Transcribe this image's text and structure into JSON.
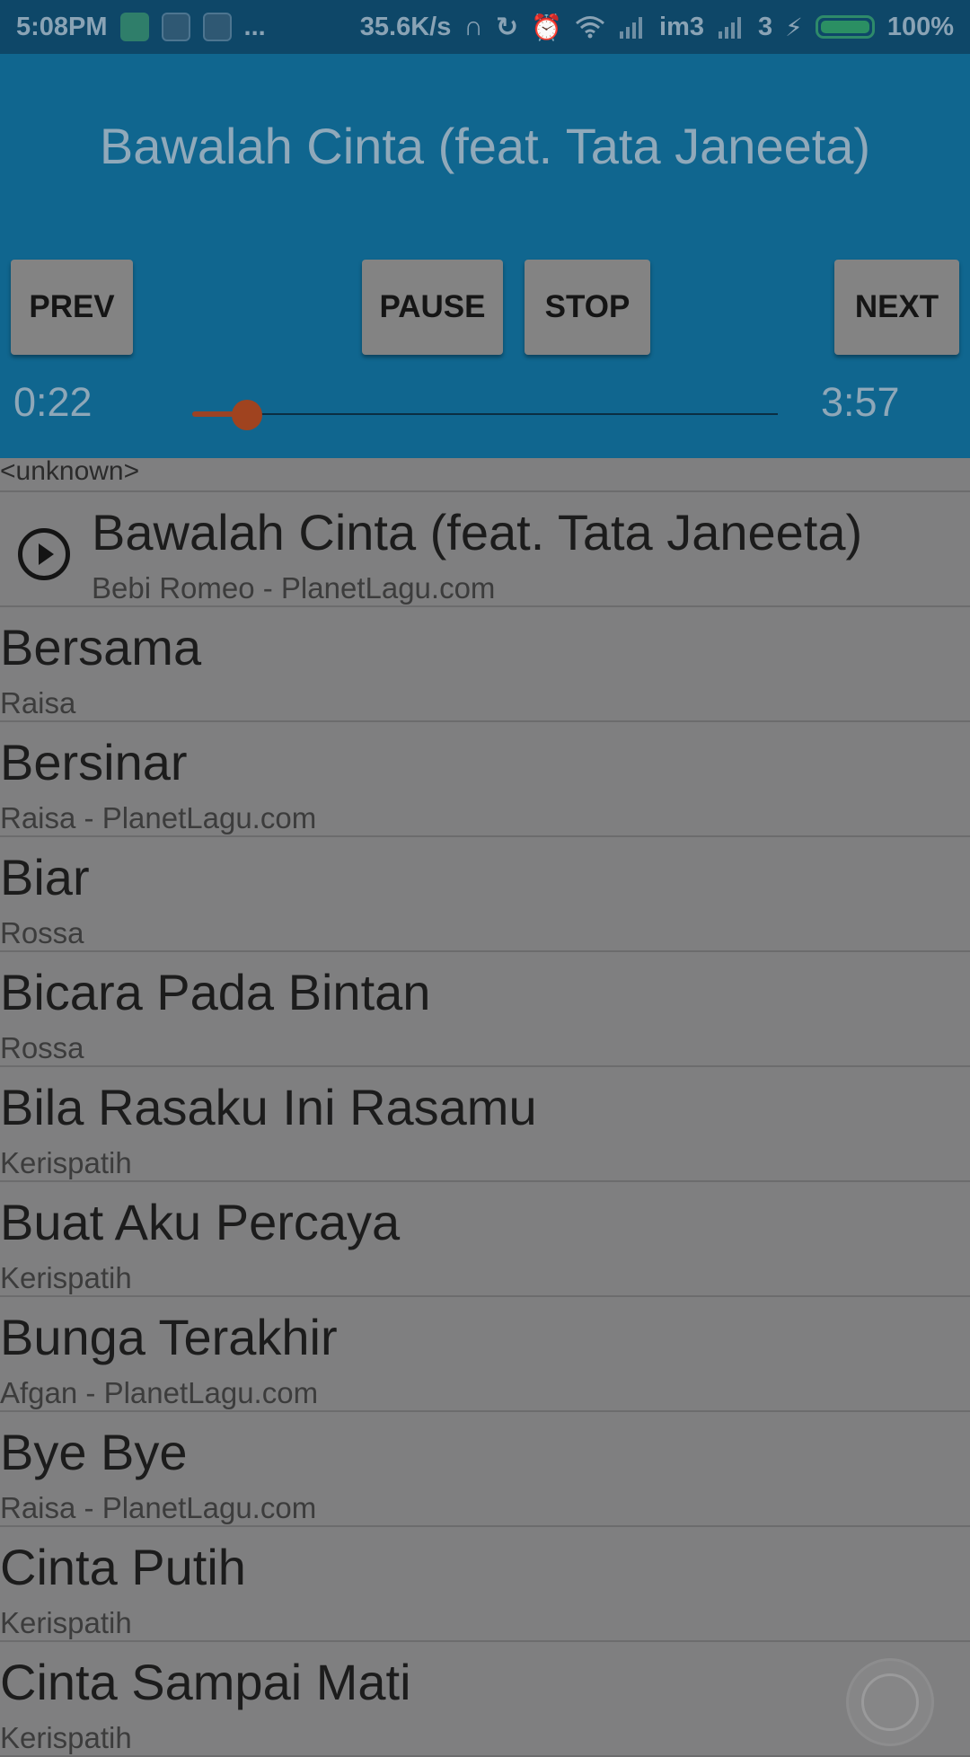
{
  "status_bar": {
    "time": "5:08PM",
    "dots": "...",
    "speed": "35.6K/s",
    "carrier1": "im3",
    "carrier2": "3",
    "battery": "100%",
    "icons": [
      "cat-app-icon",
      "bbm-icon",
      "app-icon",
      "headphones-icon",
      "sync-icon",
      "alarm-icon",
      "wifi-icon",
      "signal-icon",
      "signal-icon",
      "charging-icon",
      "battery-icon"
    ]
  },
  "player": {
    "title": "Bawalah Cinta (feat. Tata Janeeta)",
    "prev_label": "PREV",
    "pause_label": "PAUSE",
    "stop_label": "STOP",
    "next_label": "NEXT",
    "elapsed": "0:22",
    "duration": "3:57",
    "progress_fraction": 0.093
  },
  "list": {
    "group_header": "<unknown>",
    "songs": [
      {
        "title": "Bawalah Cinta (feat. Tata Janeeta)",
        "artist": "Bebi Romeo - PlanetLagu.com",
        "playing": true
      },
      {
        "title": "Bersama",
        "artist": "Raisa"
      },
      {
        "title": "Bersinar",
        "artist": "Raisa - PlanetLagu.com"
      },
      {
        "title": "Biar",
        "artist": "Rossa"
      },
      {
        "title": "Bicara Pada Bintan",
        "artist": "Rossa"
      },
      {
        "title": "Bila Rasaku Ini Rasamu",
        "artist": "Kerispatih"
      },
      {
        "title": "Buat Aku Percaya",
        "artist": "Kerispatih"
      },
      {
        "title": "Bunga Terakhir",
        "artist": "Afgan - PlanetLagu.com"
      },
      {
        "title": "Bye Bye",
        "artist": "Raisa - PlanetLagu.com"
      },
      {
        "title": "Cinta Putih",
        "artist": "Kerispatih"
      },
      {
        "title": "Cinta Sampai Mati",
        "artist": "Kerispatih"
      }
    ]
  },
  "colors": {
    "header_bg": "#10668f",
    "status_bg": "#0e4768",
    "list_bg": "#7f7f80",
    "seek_accent": "#a0431f"
  }
}
